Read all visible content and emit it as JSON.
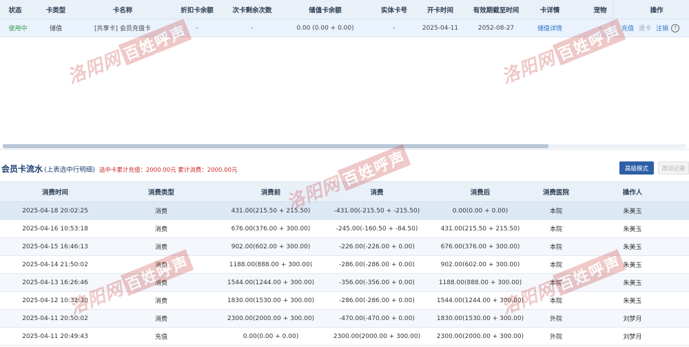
{
  "card_table": {
    "headers": [
      "状态",
      "卡类型",
      "卡名称",
      "折扣卡余额",
      "次卡剩余次数",
      "储值卡余额",
      "实体卡号",
      "开卡时间",
      "有效期截至时间",
      "卡详情",
      "宠物",
      "操作"
    ],
    "row": {
      "status": "使用中",
      "type": "储值",
      "name": "[共享卡] 会员充值卡",
      "discount_balance": "-",
      "remaining_times": "-",
      "stored_balance": "0.00 (0.00 + 0.00)",
      "physical_no": "-",
      "open_date": "2025-04-11",
      "expire_date": "2052-08-27",
      "detail_link": "储值详情",
      "pet": "-",
      "actions": {
        "recharge": "充值",
        "refund": "退卡",
        "cancel": "注销",
        "info": "!"
      }
    }
  },
  "flow_section": {
    "title": "会员卡流水",
    "subtitle": "(上表选中行明细)",
    "summary": "选中卡累计充值：2000.00元 累计消费：2000.00元",
    "btn_advanced": "高级模式",
    "btn_edit": "改动记录"
  },
  "flow_table": {
    "headers": [
      "消费时间",
      "消费类型",
      "消费前",
      "消费",
      "消费后",
      "消费医院",
      "操作人"
    ],
    "rows": [
      {
        "time": "2025-04-18 20:02:25",
        "type": "消费",
        "before": "431.00(215.50 + 215.50)",
        "amount": "-431.00(-215.50 + -215.50)",
        "after": "0.00(0.00 + 0.00)",
        "hospital": "本院",
        "operator": "朱美玉"
      },
      {
        "time": "2025-04-16 10:53:18",
        "type": "消费",
        "before": "676.00(376.00 + 300.00)",
        "amount": "-245.00(-160.50 + -84.50)",
        "after": "431.00(215.50 + 215.50)",
        "hospital": "本院",
        "operator": "朱美玉"
      },
      {
        "time": "2025-04-15 16:46:13",
        "type": "消费",
        "before": "902.00(602.00 + 300.00)",
        "amount": "-226.00(-226.00 + 0.00)",
        "after": "676.00(376.00 + 300.00)",
        "hospital": "本院",
        "operator": "朱美玉"
      },
      {
        "time": "2025-04-14 21:50:02",
        "type": "消费",
        "before": "1188.00(888.00 + 300.00)",
        "amount": "-286.00(-286.00 + 0.00)",
        "after": "902.00(602.00 + 300.00)",
        "hospital": "本院",
        "operator": "朱美玉"
      },
      {
        "time": "2025-04-13 16:26:46",
        "type": "消费",
        "before": "1544.00(1244.00 + 300.00)",
        "amount": "-356.00(-356.00 + 0.00)",
        "after": "1188.00(888.00 + 300.00)",
        "hospital": "本院",
        "operator": "朱美玉"
      },
      {
        "time": "2025-04-12 10:32:30",
        "type": "消费",
        "before": "1830.00(1530.00 + 300.00)",
        "amount": "-286.00(-286.00 + 0.00)",
        "after": "1544.00(1244.00 + 300.00)",
        "hospital": "本院",
        "operator": "朱美玉"
      },
      {
        "time": "2025-04-11 20:50:02",
        "type": "消费",
        "before": "2300.00(2000.00 + 300.00)",
        "amount": "-470.00(-470.00 + 0.00)",
        "after": "1830.00(1530.00 + 300.00)",
        "hospital": "外院",
        "operator": "刘梦月"
      },
      {
        "time": "2025-04-11 20:49:43",
        "type": "充值",
        "before": "0.00(0.00 + 0.00)",
        "amount": "2300.00(2000.00 + 300.00)",
        "after": "2300.00(2000.00 + 300.00)",
        "hospital": "外院",
        "operator": "刘梦月"
      }
    ]
  },
  "watermark": {
    "brush_text": "洛阳网",
    "box_text": "百姓呼声"
  },
  "colors": {
    "header_bg": "#e9f0f8",
    "selected_row_bg": "#eaf3fd",
    "link": "#2b73c8",
    "status_green": "#2e9a4a",
    "summary_red": "#cc2a2a",
    "button_blue": "#2d5fa8",
    "watermark_red": "#c83c3c"
  }
}
